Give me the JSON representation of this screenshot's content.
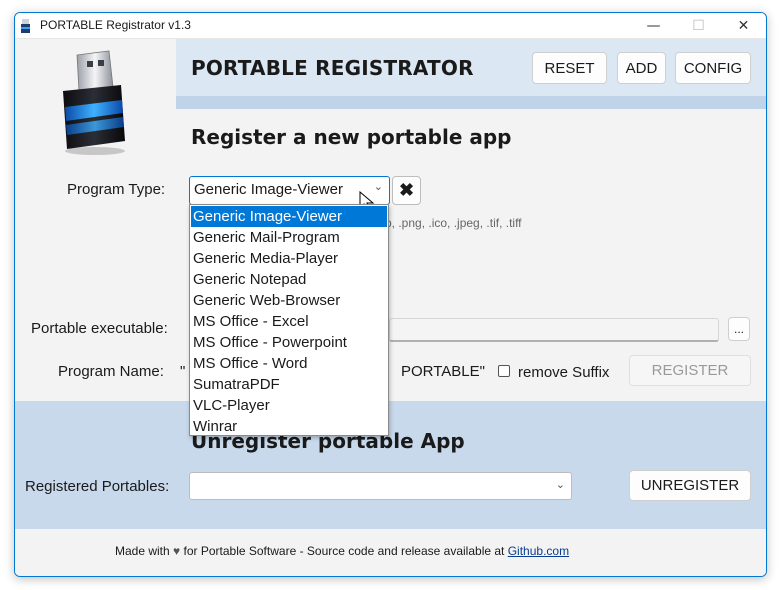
{
  "window": {
    "title": "PORTABLE Registrator v1.3",
    "controls": {
      "minimize": "—",
      "maximize": "☐",
      "close": "✕"
    }
  },
  "header": {
    "app_title": "PORTABLE REGISTRATOR",
    "buttons": {
      "reset": "RESET",
      "add": "ADD",
      "config": "CONFIG"
    }
  },
  "register": {
    "title": "Register a new portable app",
    "program_type_label": "Program Type:",
    "program_type_value": "Generic Image-Viewer",
    "extensions_text": "...mp, .png, .ico, .jpeg, .tif, .tiff",
    "portable_executable_label": "Portable executable:",
    "browse_label": "...",
    "program_name_label": "Program Name:",
    "program_name_prefix": "\"",
    "program_name_suffix": "PORTABLE\"",
    "remove_suffix_label": "remove Suffix",
    "register_button": "REGISTER",
    "dropdown_options": [
      "Generic Image-Viewer",
      "Generic Mail-Program",
      "Generic Media-Player",
      "Generic Notepad",
      "Generic Web-Browser",
      "MS Office - Excel",
      "MS Office - Powerpoint",
      "MS Office - Word",
      "SumatraPDF",
      "VLC-Player",
      "Winrar"
    ]
  },
  "unregister": {
    "title": "Unregister portable App",
    "registered_label": "Registered Portables:",
    "registered_value": "",
    "unregister_button": "UNREGISTER"
  },
  "footer": {
    "made_with": "Made with",
    "heart": "♥",
    "rest": "for Portable Software - Source code and release available at",
    "link": "Github.com"
  },
  "colors": {
    "accent": "#0078d7",
    "header_band": "#dbe8f4",
    "bottom_band": "#c8d9ec"
  }
}
